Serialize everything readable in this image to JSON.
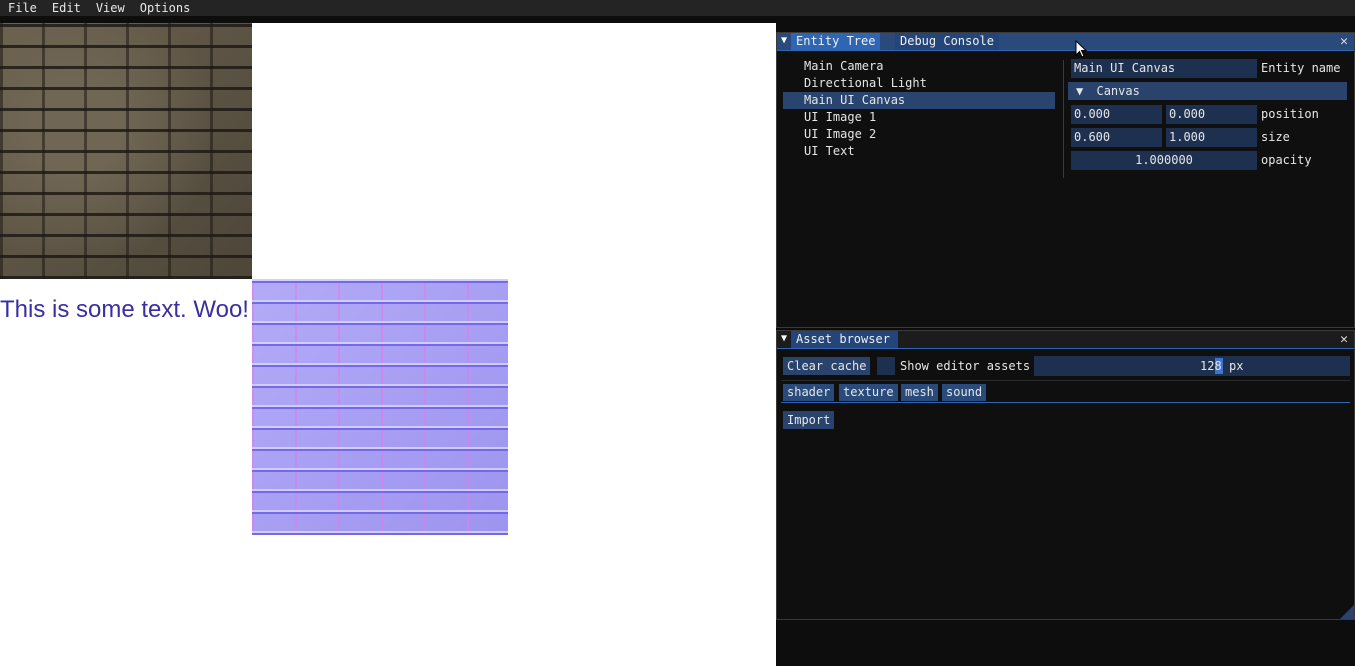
{
  "menu": [
    "File",
    "Edit",
    "View",
    "Options"
  ],
  "viewport": {
    "text": "This is some text. Woo!"
  },
  "entity_panel": {
    "tabs": [
      "Entity Tree",
      "Debug Console"
    ],
    "tree": [
      "Main Camera",
      "Directional Light",
      "Main UI Canvas",
      "UI Image 1",
      "UI Image 2",
      "UI Text"
    ],
    "selected_index": 2,
    "inspector": {
      "entity_name_value": "Main UI Canvas",
      "entity_name_label": "Entity name",
      "section": "Canvas",
      "position_x": "0.000",
      "position_y": "0.000",
      "position_label": "position",
      "size_x": "0.600",
      "size_y": "1.000",
      "size_label": "size",
      "opacity_value": "1.000000",
      "opacity_label": "opacity"
    }
  },
  "asset_panel": {
    "tab": "Asset browser",
    "clear_cache": "Clear cache",
    "show_editor_assets": "Show editor assets",
    "thumb_size": "128",
    "thumb_unit": "px",
    "types": [
      "shader",
      "texture",
      "mesh",
      "sound"
    ],
    "import": "Import"
  },
  "icons": {
    "close": "close-icon",
    "collapse": "collapse-arrow-icon",
    "section_arrow": "triangle-down-icon"
  },
  "colors": {
    "accent": "#2f66b3",
    "title_active": "#294a7a",
    "field_bg": "#1d3050",
    "selection": "#2a4470",
    "text_blue": "#3a2fa0"
  }
}
